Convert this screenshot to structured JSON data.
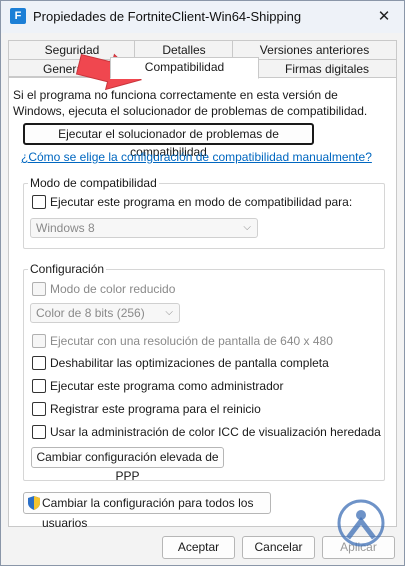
{
  "window": {
    "title": "Propiedades de FortniteClient-Win64-Shipping",
    "app_icon_letter": "F",
    "close_glyph": "✕"
  },
  "tabs": {
    "row1": [
      "Seguridad",
      "Detalles",
      "Versiones anteriores"
    ],
    "row2": [
      "General",
      "Compatibilidad",
      "Firmas digitales"
    ],
    "active": "Compatibilidad",
    "row2_visible_first": "Genera"
  },
  "intro_text": "Si el programa no funciona correctamente en esta versión de Windows, ejecuta el solucionador de problemas de compatibilidad.",
  "troubleshooter_button": "Ejecutar el solucionador de problemas de compatibilidad",
  "manual_link": "¿Cómo se elige la configuración de compatibilidad manualmente?",
  "compat_mode": {
    "group_label": "Modo de compatibilidad",
    "checkbox_label": "Ejecutar este programa en modo de compatibilidad para:",
    "checked": false,
    "os_select_value": "Windows 8"
  },
  "settings": {
    "group_label": "Configuración",
    "reduced_color_label": "Modo de color reducido",
    "color_select_value": "Color de 8 bits (256)",
    "resolution_label": "Ejecutar con una resolución de pantalla de 640 x 480",
    "fullscreen_opt_label": "Deshabilitar las optimizaciones de pantalla completa",
    "admin_label": "Ejecutar este programa como administrador",
    "restart_label": "Registrar este programa para el reinicio",
    "icc_label": "Usar la administración de color ICC de visualización heredada",
    "dpi_button": "Cambiar configuración elevada de PPP"
  },
  "all_users_button": "Cambiar la configuración para todos los usuarios",
  "footer": {
    "accept": "Aceptar",
    "cancel": "Cancelar",
    "apply": "Aplicar"
  },
  "colors": {
    "accent_red": "#f0474f",
    "link_blue": "#0067c0",
    "watermark_blue": "#3d6fb5"
  }
}
